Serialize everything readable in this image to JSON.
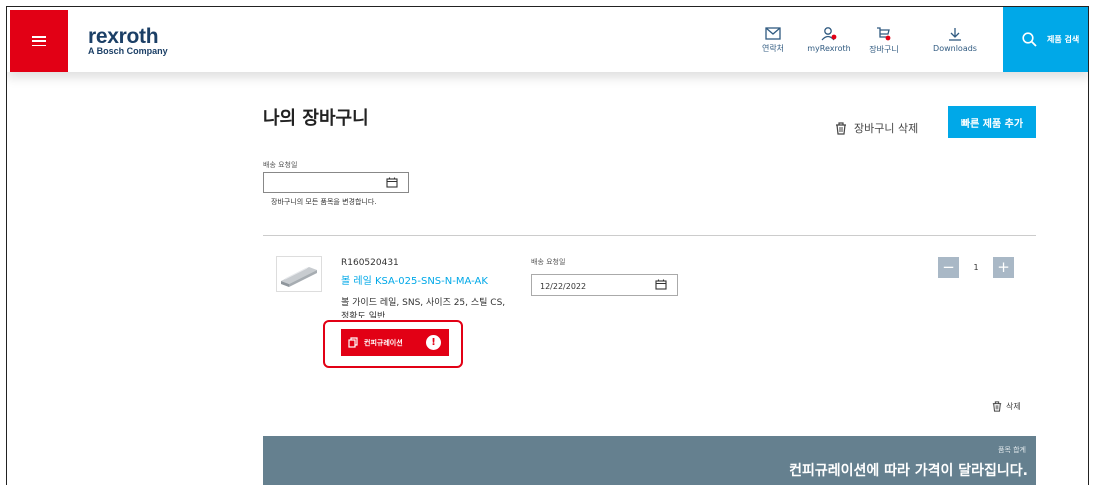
{
  "header": {
    "logo": {
      "brand": "rexroth",
      "subtitle": "A Bosch Company"
    },
    "nav": {
      "contact": "연락처",
      "my_rexroth": "myRexroth",
      "cart": "장바구니",
      "downloads": "Downloads"
    },
    "search_label": "제품 검색"
  },
  "page": {
    "title": "나의 장바구니",
    "cart_delete_label": "장바구니 삭제",
    "quick_add_label": "빠른 제품 추가",
    "requested_date_label": "배송 요청일",
    "requested_date_value": "",
    "change_all_note": "장바구니의 모든 품목을 변경합니다."
  },
  "item": {
    "number": "R160520431",
    "name": "볼 레일 KSA-025-SNS-N-MA-AK",
    "description": "볼 가이드 레일, SNS, 사이즈 25, 스틸 CS, 정확도 일반",
    "config_label": "컨피규레이션",
    "alert_symbol": "!",
    "requested_date_label": "배송 요청일",
    "requested_date_value": "12/22/2022",
    "quantity": "1",
    "minus": "−",
    "plus": "+",
    "delete_label": "삭제"
  },
  "total": {
    "label": "품목 합계",
    "note": "컨피규레이션에 따라 가격이 달라집니다."
  },
  "colors": {
    "brand_red": "#e20015",
    "accent_blue": "#00a8e8",
    "logo_navy": "#1b3f66",
    "total_bar": "#65808f"
  }
}
